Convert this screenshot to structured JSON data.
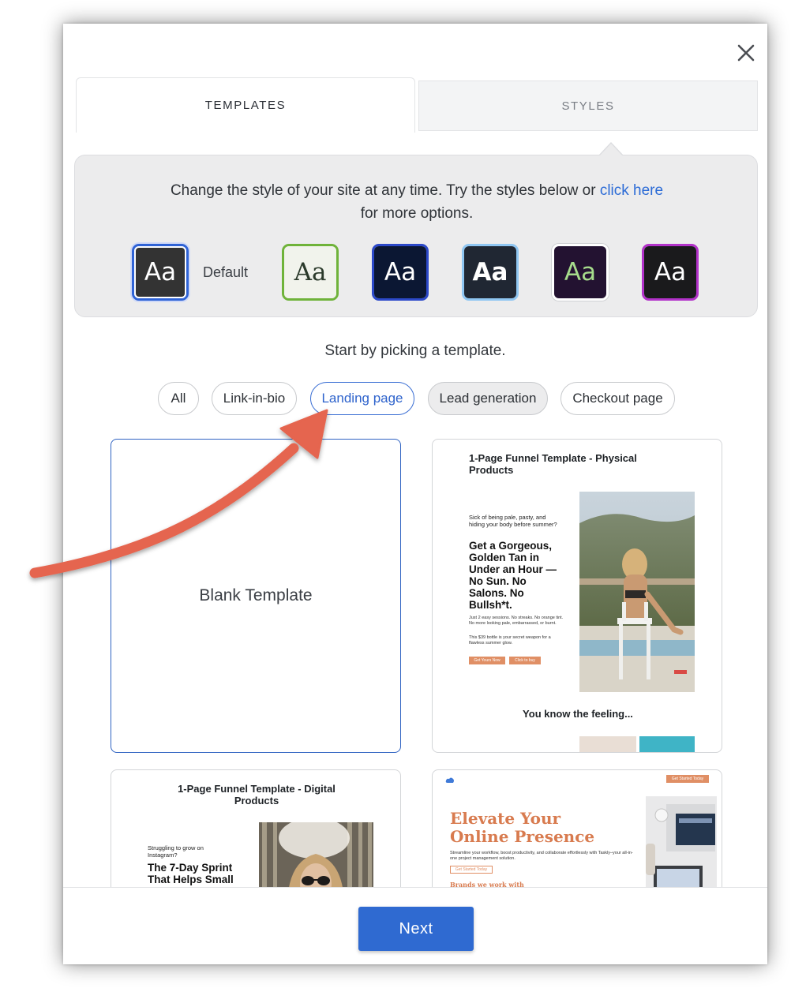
{
  "tabs": {
    "templates": "TEMPLATES",
    "styles": "STYLES"
  },
  "styles_panel": {
    "text_before": "Change the style of your site at any time. Try the styles below or ",
    "link_text": "click here",
    "text_after": "for more options.",
    "swatch_glyph": "Aa",
    "default_label": "Default"
  },
  "colors": {
    "accent": "#2f6ad1",
    "annotation_arrow": "#e5654f"
  },
  "pick_text": "Start by picking a template.",
  "filters": [
    "All",
    "Link-in-bio",
    "Landing page",
    "Lead generation",
    "Checkout page"
  ],
  "cards": {
    "blank": {
      "label": "Blank Template"
    },
    "physical": {
      "title": "1-Page Funnel Template - Physical Products",
      "eyebrow": "Sick of being pale, pasty, and hiding your body before summer?",
      "headline": "Get a Gorgeous, Golden Tan in Under an Hour — No Sun. No Salons. No Bullsh*t.",
      "body1": "Just 2 easy sessions. No streaks. No orange tint. No more looking pale, embarrassed, or burnt.",
      "body2": "This $39 bottle is your secret weapon for a flawless summer glow.",
      "btn1": "Get Yours Now",
      "btn2": "Click to buy",
      "section": "You know the feeling..."
    },
    "digital": {
      "title": "1-Page Funnel Template - Digital Products",
      "eyebrow": "Struggling to grow on Instagram?",
      "headline": "The 7-Day Sprint That Helps Small"
    },
    "saas": {
      "top_btn": "Get Started Today",
      "headline": "Elevate Your Online Presence",
      "body": "Streamline your workflow, boost productivity, and collaborate effortlessly with Taskly–your all-in-one project management solution.",
      "cta": "Get Started Today",
      "subhead": "Brands we work with"
    }
  },
  "next_label": "Next"
}
